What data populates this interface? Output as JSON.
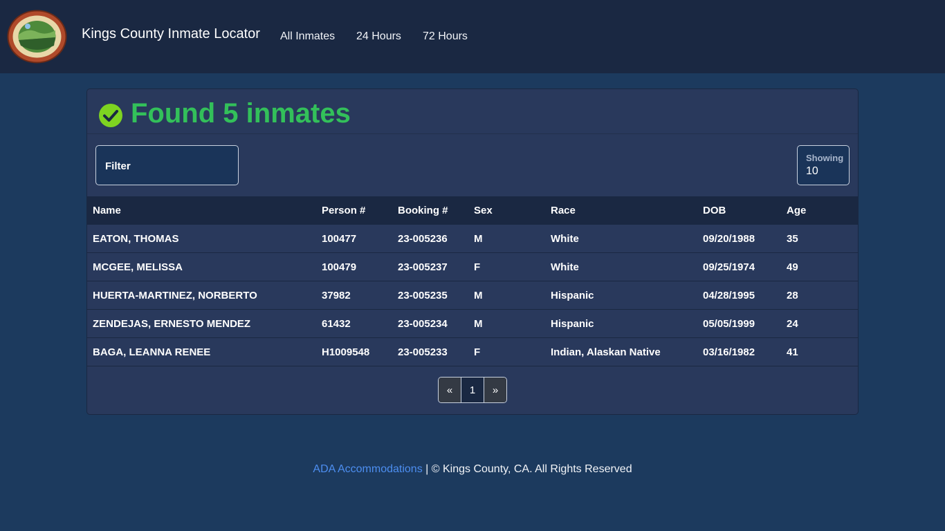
{
  "header": {
    "brand": "Kings County Inmate Locator",
    "nav": [
      "All Inmates",
      "24 Hours",
      "72 Hours"
    ]
  },
  "result": {
    "title": "Found 5 inmates"
  },
  "controls": {
    "filter_label": "Filter",
    "showing_label": "Showing",
    "showing_value": "10"
  },
  "table": {
    "columns": [
      "Name",
      "Person #",
      "Booking #",
      "Sex",
      "Race",
      "DOB",
      "Age"
    ],
    "rows": [
      [
        "EATON, THOMAS",
        "100477",
        "23-005236",
        "M",
        "White",
        "09/20/1988",
        "35"
      ],
      [
        "MCGEE, MELISSA",
        "100479",
        "23-005237",
        "F",
        "White",
        "09/25/1974",
        "49"
      ],
      [
        "HUERTA-MARTINEZ, NORBERTO",
        "37982",
        "23-005235",
        "M",
        "Hispanic",
        "04/28/1995",
        "28"
      ],
      [
        "ZENDEJAS, ERNESTO MENDEZ",
        "61432",
        "23-005234",
        "M",
        "Hispanic",
        "05/05/1999",
        "24"
      ],
      [
        "BAGA, LEANNA RENEE",
        "H1009548",
        "23-005233",
        "F",
        "Indian, Alaskan Native",
        "03/16/1982",
        "41"
      ]
    ]
  },
  "pagination": {
    "prev": "«",
    "current": "1",
    "next": "»"
  },
  "footer": {
    "link": "ADA Accommodations",
    "text": " | © Kings County, CA. All Rights Reserved"
  },
  "colors": {
    "page_bg": "#1c3a5e",
    "nav_bg": "#1a2842",
    "card_bg": "#29395c",
    "success": "#33c05a",
    "check": "#7ed321",
    "link": "#4d8ef0"
  }
}
